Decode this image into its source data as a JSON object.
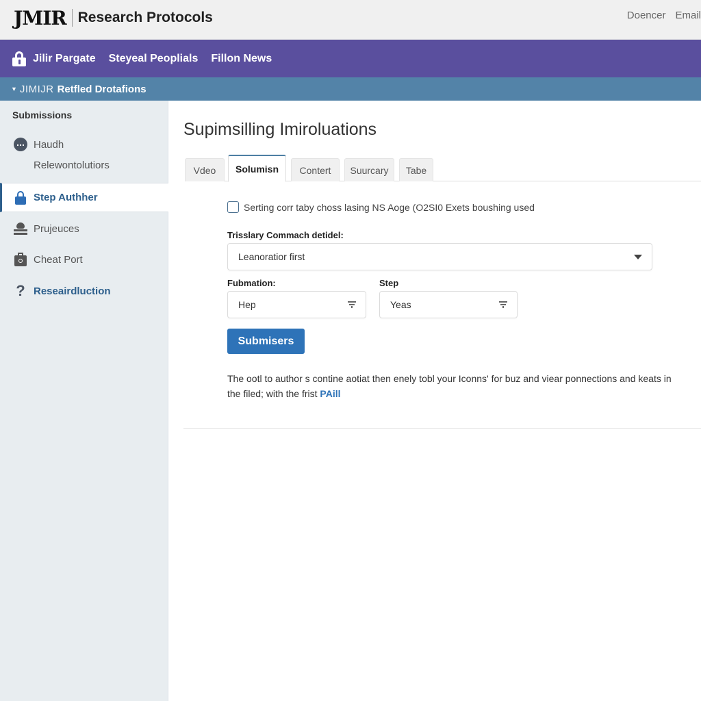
{
  "header": {
    "logo": "JMIR",
    "journal_name": "Research Protocols",
    "links": [
      "Doencer",
      "Email"
    ]
  },
  "navbar": {
    "icon": "lock-icon",
    "items": [
      "Jilir Pargate",
      "Steyeal Peoplials",
      "Fillon News"
    ]
  },
  "subbar": {
    "prefix": "JIMIJR",
    "title": "Retfled Drotafions"
  },
  "sidebar": {
    "heading": "Submissions",
    "items": [
      {
        "label": "Haudh",
        "icon": "dashboard-icon"
      },
      {
        "label": "Relewontolutiors",
        "icon": null
      },
      {
        "label": "Step Authher",
        "icon": "lock-icon",
        "active": true
      },
      {
        "label": "Prujeuces",
        "icon": "user-icon"
      },
      {
        "label": "Cheat Port",
        "icon": "briefcase-icon"
      },
      {
        "label": "Reseairdluction",
        "icon": "question-icon"
      }
    ]
  },
  "main": {
    "title": "Supimsilling Imiroluations",
    "tabs": [
      {
        "label": "Vdeo",
        "active": false
      },
      {
        "label": "Solumisn",
        "active": true
      },
      {
        "label": "Contert",
        "active": false
      },
      {
        "label": "Suurcary",
        "active": false
      },
      {
        "label": "Tabe",
        "active": false
      }
    ],
    "checkbox": {
      "label": "Serting corr taby choss lasing NS Aoge (O2SI0 Exets boushing used",
      "checked": false
    },
    "primary_select": {
      "label": "Trisslary Commach detidel:",
      "value": "Leanoratior first"
    },
    "formation_select": {
      "label": "Fubmation:",
      "value": "Hep"
    },
    "step_select": {
      "label": "Step",
      "value": "Yeas"
    },
    "submit_label": "Submisers",
    "help": {
      "line1": "The ootl to author s contine aotiat then enely tobl your Iconns' for buz and viear ponnections and keats in",
      "line2": "the filed; with the frist ",
      "link": "PAill"
    }
  },
  "colors": {
    "nav_purple": "#5a4f9e",
    "subbar_blue": "#5383a8",
    "accent_blue": "#2e73b8",
    "sidebar_bg": "#e8edf0"
  }
}
